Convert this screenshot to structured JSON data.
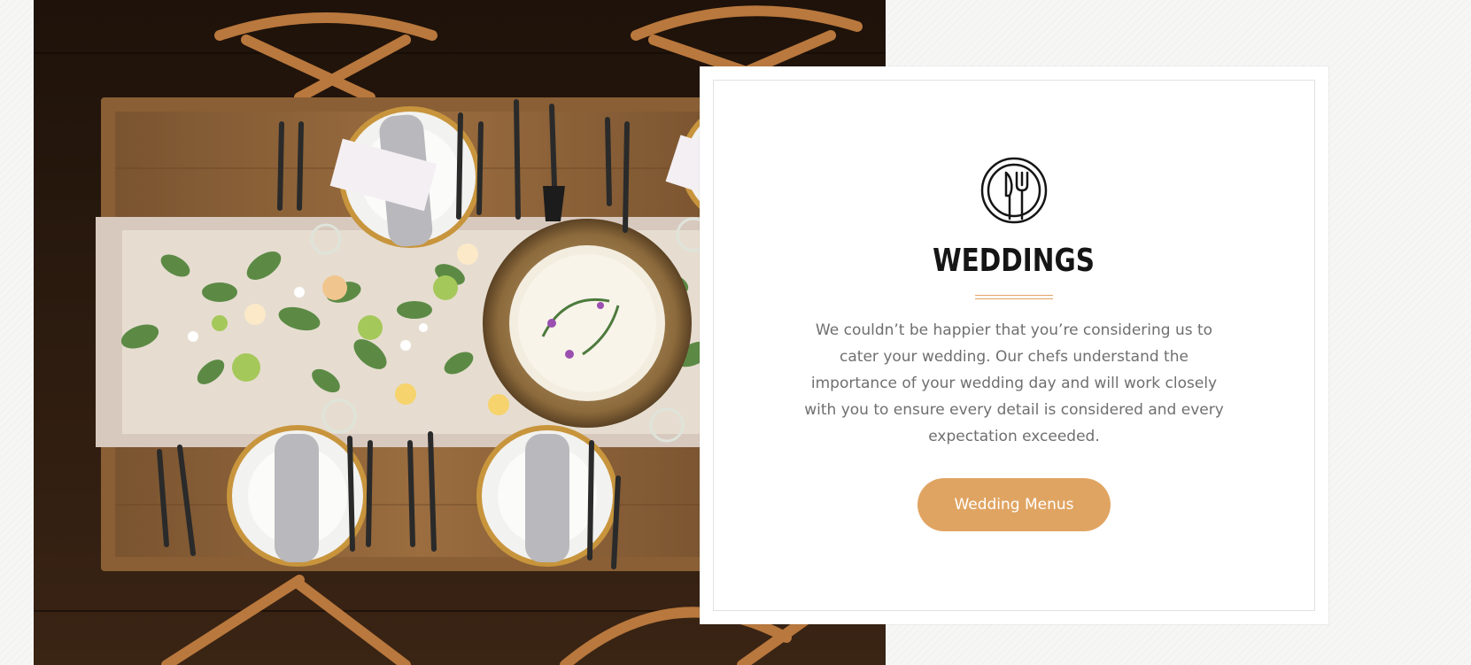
{
  "hero_image": {
    "subject": "table-setting-photo"
  },
  "card": {
    "icon": "plate-fork-knife-icon",
    "title": "WEDDINGS",
    "description": "We couldn’t be happier that you’re considering us to cater your wedding. Our chefs understand the importance of your wedding day and will work closely with you to ensure every detail is considered and every expectation exceeded.",
    "button_label": "Wedding Menus"
  },
  "colors": {
    "accent": "#e0a462",
    "title": "#151515",
    "body_text": "#6f6f6f",
    "card_background": "#ffffff",
    "page_background": "#f6f6f5"
  }
}
